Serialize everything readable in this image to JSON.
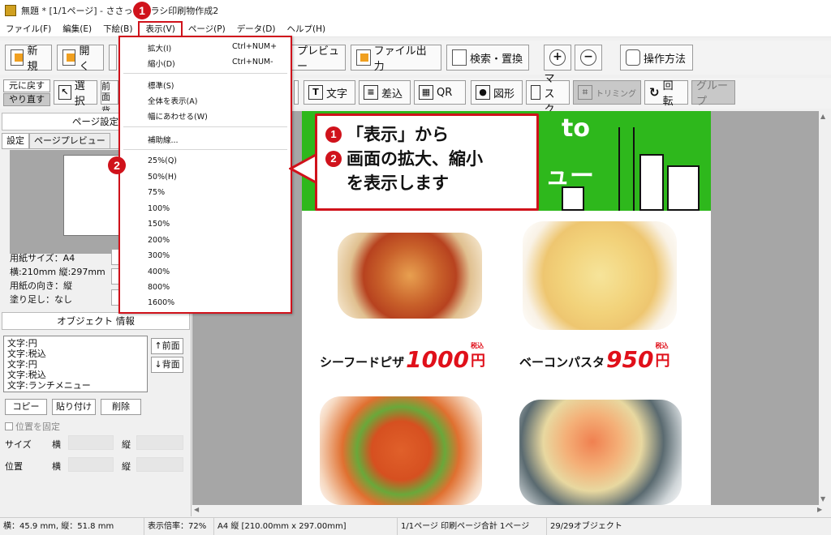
{
  "window": {
    "title": "無題 * [1/1ページ] - ささっとチラシ印刷物作成2"
  },
  "menubar": [
    "ファイル(F)",
    "編集(E)",
    "下絵(B)",
    "表示(V)",
    "ページ(P)",
    "データ(D)",
    "ヘルプ(H)"
  ],
  "toolbar1": {
    "new": "新規",
    "open": "開く",
    "preview": "プレビュー",
    "export": "ファイル出力",
    "search": "検索・置換",
    "zoom_in": "+",
    "zoom_out": "−",
    "howto": "操作方法"
  },
  "toolbar2": {
    "undo": "元に戻す",
    "redo": "やり直す",
    "select": "選択",
    "front": "前面",
    "back": "背面",
    "text": "文字",
    "insert": "差込",
    "qr": "QR",
    "shape": "図形",
    "mask": "マスク",
    "trim": "トリミング",
    "rotate": "回転",
    "group": "グループ"
  },
  "left_panel": {
    "page_settings": "ページ設定",
    "tabs": [
      "設定",
      "ページプレビュー"
    ],
    "paper_size": "用紙サイズ：A4",
    "dimensions": "横:210mm 縦:297mm",
    "orientation": "用紙の向き：縦",
    "bleed": "塗り足し：なし",
    "object_info": "オブジェクト 情報",
    "objects": [
      "文字:円",
      "文字:税込",
      "文字:円",
      "文字:税込",
      "文字:ランチメニュー"
    ],
    "front_btn": "↑前面",
    "back_btn": "↓背面",
    "copy": "コピー",
    "paste": "貼り付け",
    "delete": "削除",
    "lock": "位置を固定",
    "size_label": "サイズ",
    "pos_label": "位置",
    "horiz": "横",
    "vert": "縦"
  },
  "view_menu": {
    "items": [
      {
        "label": "拡大(I)",
        "shortcut": "Ctrl+NUM+"
      },
      {
        "label": "縮小(D)",
        "shortcut": "Ctrl+NUM-"
      },
      {
        "label": "標準(S)"
      },
      {
        "label": "全体を表示(A)"
      },
      {
        "label": "幅にあわせる(W)"
      },
      {
        "label": "補助線..."
      },
      {
        "label": "25%(Q)"
      },
      {
        "label": "50%(H)"
      },
      {
        "label": "75%"
      },
      {
        "label": "100%"
      },
      {
        "label": "150%"
      },
      {
        "label": "200%"
      },
      {
        "label": "300%"
      },
      {
        "label": "400%"
      },
      {
        "label": "800%"
      },
      {
        "label": "1600%"
      }
    ]
  },
  "flyer": {
    "band_text_1": "to",
    "band_text_2": "ュー",
    "dishes": [
      {
        "name": "シーフードピザ",
        "price": "1000",
        "yen": "円",
        "tax": "税込"
      },
      {
        "name": "ベーコンパスタ",
        "price": "950",
        "yen": "円",
        "tax": "税込"
      }
    ]
  },
  "callout": {
    "badge1": "1",
    "badge2": "2",
    "line1": "「表示」から",
    "line2": "画面の拡大、縮小",
    "line3": "を表示します"
  },
  "statusbar": {
    "cursor": "横：45.9 mm, 縦：51.8 mm",
    "zoom": "表示倍率：72%",
    "paper": "A4 縦 [210.00mm x 297.00mm]",
    "pages": "1/1ページ 印刷ページ合計 1ページ",
    "objects": "29/29オブジェクト"
  },
  "colors": {
    "accent_red": "#d0121b",
    "flyer_green": "#2eb81c",
    "price_red": "#e0101a"
  }
}
